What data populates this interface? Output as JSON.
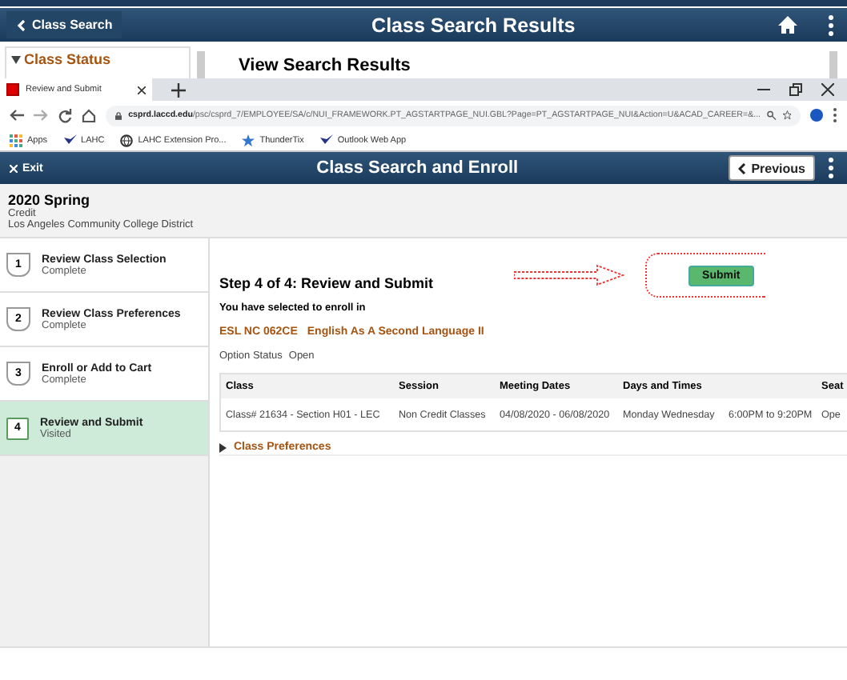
{
  "back_page": {
    "back_button": "Class Search",
    "title": "Class Search Results",
    "side_panel": {
      "title": "Class Status",
      "expanded": true
    },
    "heading": "View Search Results"
  },
  "browser": {
    "tab": "Review and Submit",
    "url_domain": "csprd.laccd.edu",
    "url_path": "/psc/csprd_7/EMPLOYEE/SA/c/NUI_FRAMEWORK.PT_AGSTARTPAGE_NUI.GBL?Page=PT_AGSTARTPAGE_NUI&Action=U&ACAD_CAREER=&...",
    "bookmarks": [
      {
        "label": "Apps",
        "kind": "apps"
      },
      {
        "label": "LAHC",
        "kind": "logo"
      },
      {
        "label": "LAHC Extension Pro...",
        "kind": "globe"
      },
      {
        "label": "ThunderTix",
        "kind": "star"
      },
      {
        "label": "Outlook Web App",
        "kind": "logo"
      }
    ]
  },
  "header": {
    "exit": "Exit",
    "title": "Class Search and Enroll",
    "previous": "Previous"
  },
  "term": {
    "name": "2020 Spring",
    "career": "Credit",
    "institution": "Los Angeles Community College District"
  },
  "steps": [
    {
      "number": "1",
      "title": "Review Class Selection",
      "status": "Complete",
      "selected": false
    },
    {
      "number": "2",
      "title": "Review Class Preferences",
      "status": "Complete",
      "selected": false
    },
    {
      "number": "3",
      "title": "Enroll or Add to Cart",
      "status": "Complete",
      "selected": false
    },
    {
      "number": "4",
      "title": "Review and Submit",
      "status": "Visited",
      "selected": true
    }
  ],
  "main": {
    "heading": "Step 4 of 4: Review and Submit",
    "intro": "You have selected to enroll in",
    "course_code": "ESL NC 062CE",
    "course_title": "English As A Second Language II",
    "option_status_label": "Option Status",
    "option_status": "Open",
    "submit": "Submit",
    "table": {
      "columns": [
        "Class",
        "Session",
        "Meeting Dates",
        "Days and Times",
        "",
        "Seat"
      ],
      "rows": [
        {
          "cells": [
            "Class# 21634 - Section H01 - LEC",
            "Non Credit Classes",
            "04/08/2020 - 06/08/2020",
            "Monday Wednesday",
            "6:00PM to 9:20PM",
            "Ope"
          ]
        }
      ]
    },
    "preferences": {
      "label": "Class Preferences",
      "expanded": false
    }
  }
}
